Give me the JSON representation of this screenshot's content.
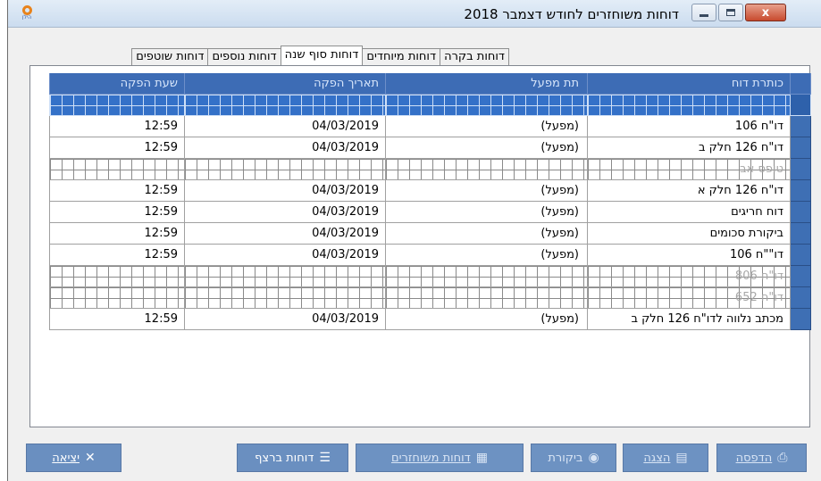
{
  "window": {
    "title": "דוחות משוחזרים לחודש דצמבר 2018",
    "icon_letter": "O",
    "icon_caption": "הילן",
    "close_label": "x"
  },
  "tabs": [
    {
      "label": "דוחות בקרה",
      "active": false
    },
    {
      "label": "דוחות מיוחדים",
      "active": false
    },
    {
      "label": "דוחות סוף שנה",
      "active": true
    },
    {
      "label": "דוחות נוספים",
      "active": false
    },
    {
      "label": "דוחות שוטפים",
      "active": false
    }
  ],
  "table": {
    "columns": {
      "title": "כותרת דוח",
      "plant": "תת מפעל",
      "date": "תאריך הפקה",
      "time": "שעת הפקה"
    },
    "rows": [
      {
        "title": "",
        "plant": "",
        "date": "",
        "time": "",
        "state": "selected"
      },
      {
        "title": "דו\"ח 106",
        "plant": "(מפעל)",
        "date": "04/03/2019",
        "time": "12:59",
        "state": "normal"
      },
      {
        "title": "דו\"ח 126 חלק ב",
        "plant": "(מפעל)",
        "date": "04/03/2019",
        "time": "12:59",
        "state": "normal"
      },
      {
        "title": "טופס אב",
        "plant": "",
        "date": "",
        "time": "",
        "state": "empty"
      },
      {
        "title": "דו\"ח 126 חלק א",
        "plant": "(מפעל)",
        "date": "04/03/2019",
        "time": "12:59",
        "state": "normal"
      },
      {
        "title": "דוח חריגים",
        "plant": "(מפעל)",
        "date": "04/03/2019",
        "time": "12:59",
        "state": "normal"
      },
      {
        "title": "ביקורת סכומים",
        "plant": "(מפעל)",
        "date": "04/03/2019",
        "time": "12:59",
        "state": "normal"
      },
      {
        "title": "דו\"\"ח 106",
        "plant": "(מפעל)",
        "date": "04/03/2019",
        "time": "12:59",
        "state": "normal"
      },
      {
        "title": "דו\"ח 806",
        "plant": "",
        "date": "",
        "time": "",
        "state": "empty"
      },
      {
        "title": "דו\"ח 652",
        "plant": "",
        "date": "",
        "time": "",
        "state": "empty"
      },
      {
        "title": "מכתב נלווה לדו\"ח 126 חלק ב",
        "plant": "(מפעל)",
        "date": "04/03/2019",
        "time": "12:59",
        "state": "normal"
      }
    ]
  },
  "buttons": {
    "print": "הדפסה",
    "show": "הצגה",
    "review": "ביקורת",
    "returned_reports": "דוחות משוחזרים",
    "continuous_reports": "דוחות ברצף",
    "exit": "יציאה"
  },
  "icons": {
    "print": "printer-icon",
    "show": "monitor-icon",
    "review": "eye-icon",
    "returned": "document-icon",
    "continuous": "stack-icon",
    "exit": "x-icon"
  }
}
